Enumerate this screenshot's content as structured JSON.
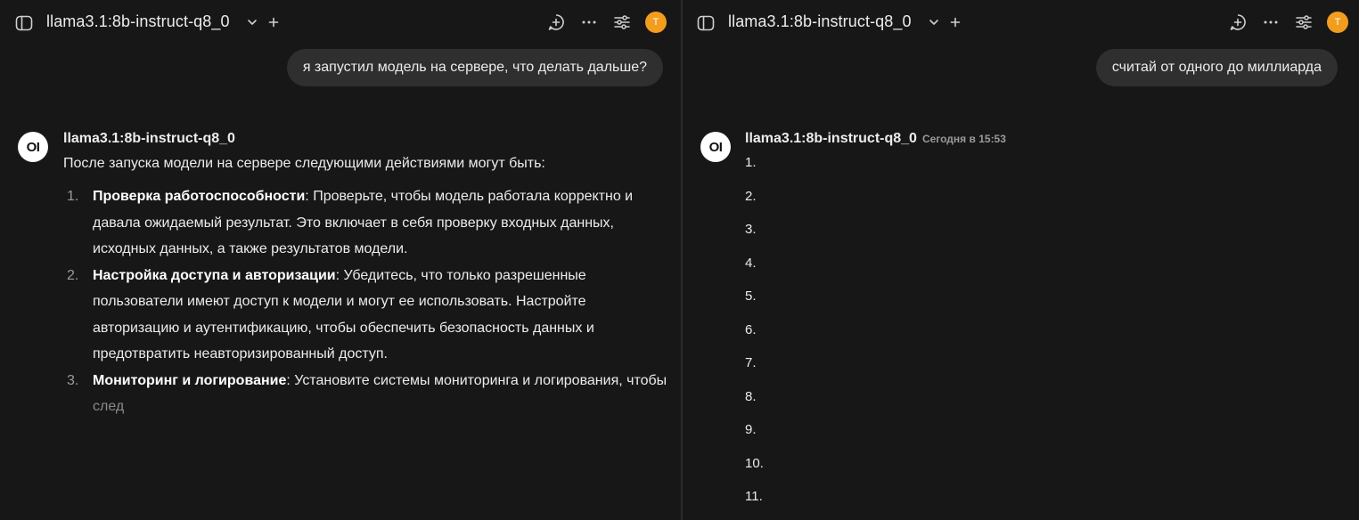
{
  "left": {
    "model": "llama3.1:8b-instruct-q8_0",
    "avatar_initial": "T",
    "user_message": "я запустил модель на сервере, что делать дальше?",
    "assistant": {
      "logo": "OI",
      "name": "llama3.1:8b-instruct-q8_0",
      "intro": "После запуска модели на сервере следующими действиями могут быть:",
      "items": [
        {
          "num": "1.",
          "title": "Проверка работоспособности",
          "text": ": Проверьте, чтобы модель работала корректно и давала ожидаемый результат. Это включает в себя проверку входных данных, исходных данных, а также результатов модели."
        },
        {
          "num": "2.",
          "title": "Настройка доступа и авторизации",
          "text": ": Убедитесь, что только разрешенные пользователи имеют доступ к модели и могут ее использовать. Настройте авторизацию и аутентификацию, чтобы обеспечить безопасность данных и предотвратить неавторизированный доступ."
        },
        {
          "num": "3.",
          "title": "Мониторинг и логирование",
          "text": ": Установите системы мониторинга и логирования, чтобы ",
          "faded": "след"
        }
      ]
    }
  },
  "right": {
    "model": "llama3.1:8b-instruct-q8_0",
    "avatar_initial": "T",
    "user_message": "считай от одного до миллиарда",
    "assistant": {
      "logo": "OI",
      "name": "llama3.1:8b-instruct-q8_0",
      "time": "Сегодня в 15:53",
      "counts": [
        "1.",
        "2.",
        "3.",
        "4.",
        "5.",
        "6.",
        "7.",
        "8.",
        "9.",
        "10.",
        "11."
      ]
    }
  },
  "icons": [
    "sidebar-toggle-icon",
    "chevron-down-icon",
    "plus-icon",
    "new-chat-icon",
    "more-icon",
    "settings-sliders-icon"
  ],
  "colors": {
    "background": "#171717",
    "bubble": "#2f2f2f",
    "avatar": "#f29d1e",
    "text": "#ececec"
  }
}
